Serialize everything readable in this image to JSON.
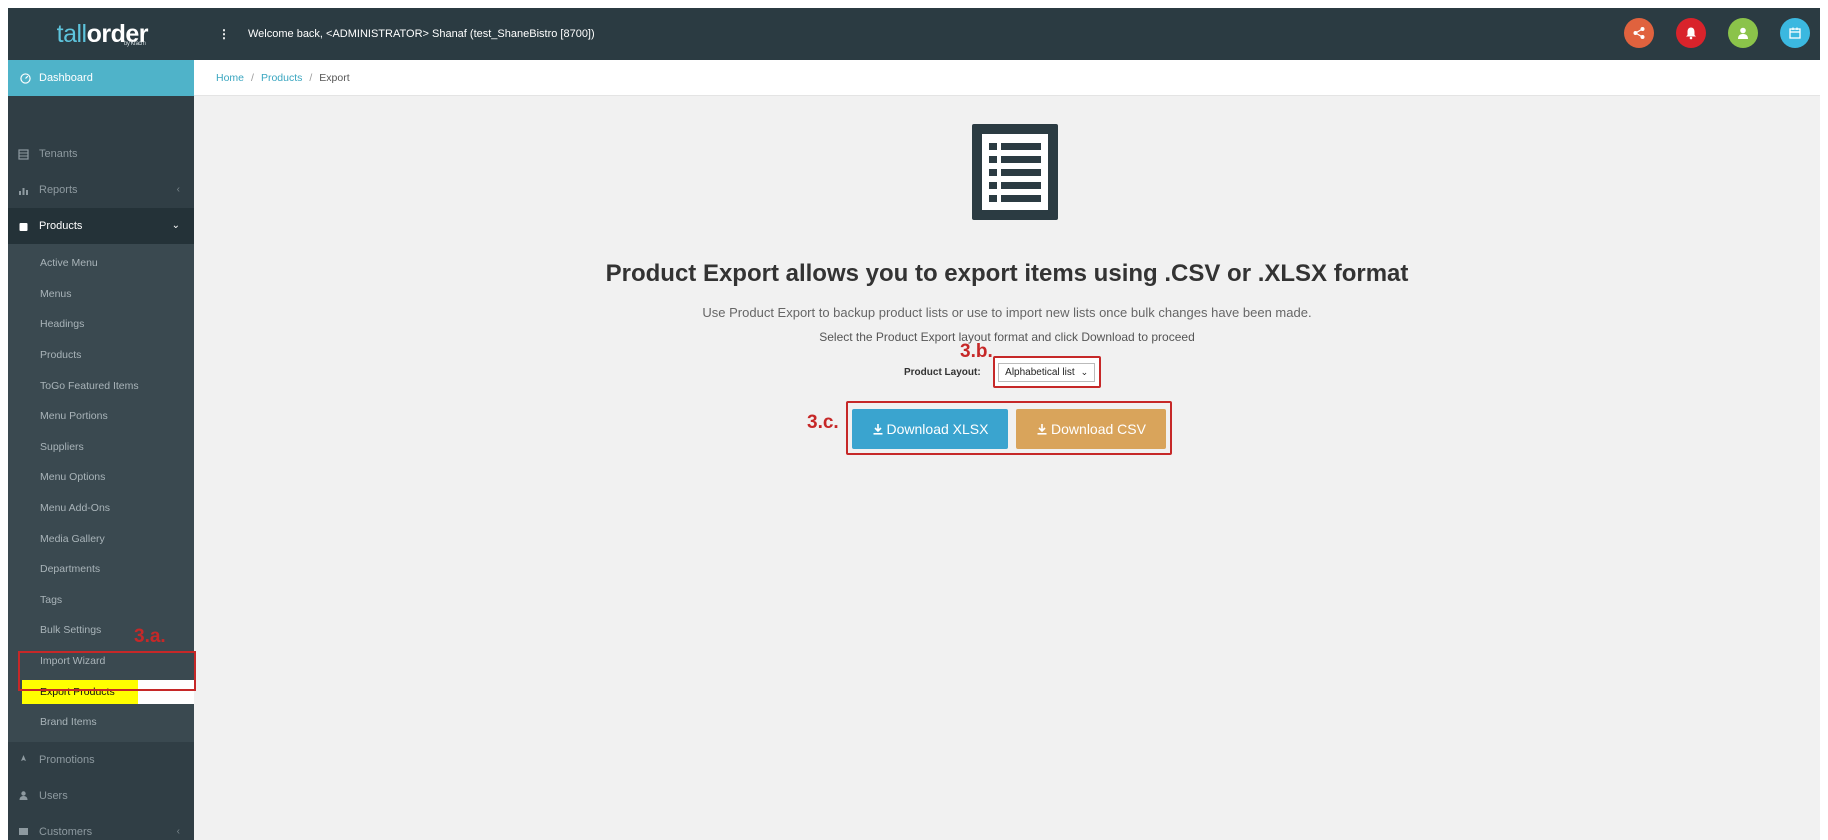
{
  "app": {
    "logo_part1": "tall",
    "logo_part2": "order",
    "logo_sub": "by Kracm"
  },
  "topbar": {
    "menu_dots": "⋮",
    "welcome_text": "Welcome back, <ADMINISTRATOR> Shanaf (test_ShaneBistro [8700])",
    "icons": [
      {
        "name": "share-icon",
        "color": "#e0623e"
      },
      {
        "name": "bell-icon",
        "color": "#d9232b"
      },
      {
        "name": "user-icon",
        "color": "#8bc34a"
      },
      {
        "name": "calendar-icon",
        "color": "#3bb8e0"
      }
    ]
  },
  "sidebar": {
    "dashboard": "Dashboard",
    "items": [
      {
        "label": "Tenants",
        "icon": "table-icon"
      },
      {
        "label": "Reports",
        "icon": "bar-chart-icon",
        "chevron": "‹"
      },
      {
        "label": "Products",
        "icon": "box-icon",
        "chevron": "⌄",
        "active": true
      }
    ],
    "products_sub": [
      "Active Menu",
      "Menus",
      "Headings",
      "Products",
      "ToGo Featured Items",
      "Menu Portions",
      "Suppliers",
      "Menu Options",
      "Menu Add-Ons",
      "Media Gallery",
      "Departments",
      "Tags",
      "Bulk Settings",
      "Import Wizard",
      "Export Products",
      "Brand Items"
    ],
    "bottom_items": [
      {
        "label": "Promotions",
        "icon": "rocket-icon"
      },
      {
        "label": "Users",
        "icon": "user-icon"
      },
      {
        "label": "Customers",
        "icon": "address-card-icon",
        "chevron": "‹"
      }
    ]
  },
  "breadcrumb": {
    "home": "Home",
    "products": "Products",
    "current": "Export",
    "separator": "/"
  },
  "main": {
    "headline": "Product Export allows you to export items using .CSV or .XLSX format",
    "desc1": "Use Product Export to backup product lists or use to import new lists once bulk changes have been made.",
    "desc2": "Select the Product Export layout format and click Download to proceed",
    "layout_label": "Product Layout:",
    "layout_value": "Alphabetical list",
    "download_xlsx": "Download XLSX",
    "download_csv": "Download CSV"
  },
  "annotations": {
    "tag_3a": "3.a.",
    "tag_3b": "3.b.",
    "tag_3c": "3.c.",
    "color": "#c62828"
  },
  "colors": {
    "topbar": "#2b3b42",
    "accent": "#4fb3c9",
    "xlsx_button": "#3aa4cf",
    "csv_button": "#d9a45b",
    "highlight": "#ffff00"
  }
}
